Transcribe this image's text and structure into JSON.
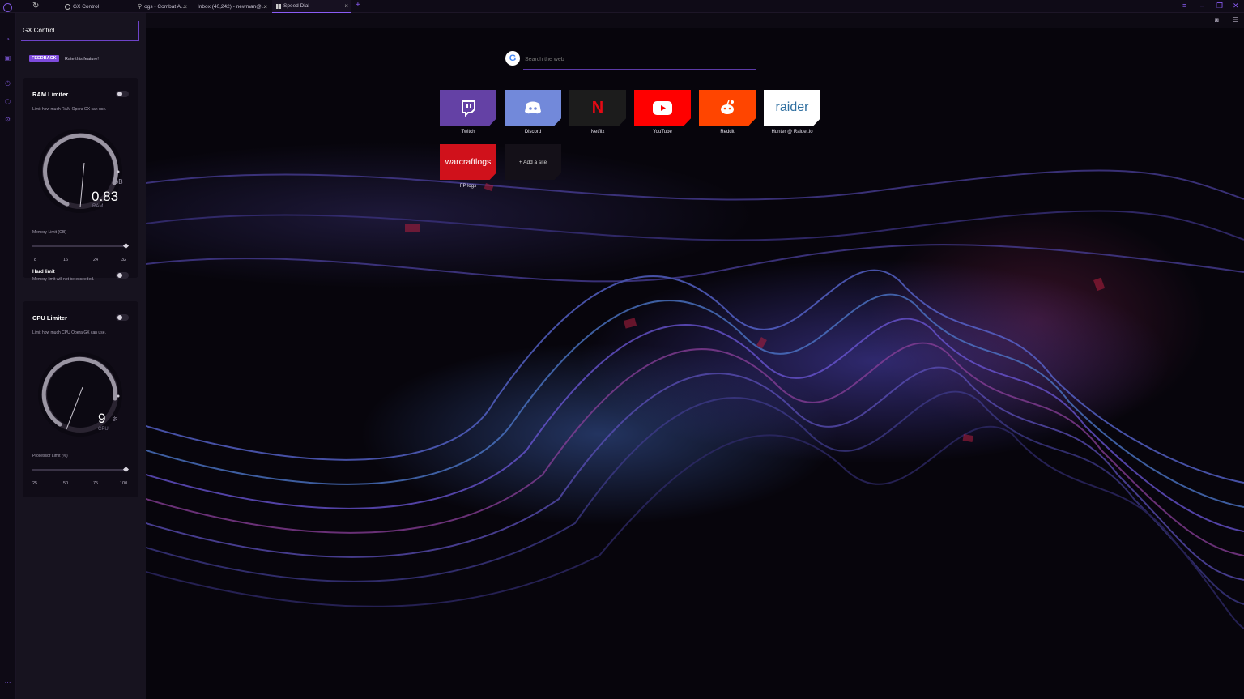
{
  "browser": {
    "tabs": [
      {
        "label": "GX Control",
        "icon": "globe-icon"
      },
      {
        "label": "ogs - Combat A…",
        "icon": "pin-icon"
      },
      {
        "label": "Inbox (40,242) - newman@…",
        "icon": "gmail-icon"
      },
      {
        "label": "Speed Dial",
        "icon": "grid-icon"
      }
    ]
  },
  "panel": {
    "title": "GX Control",
    "feedback_label": "FEEDBACK",
    "rate_text": "Rate this feature!",
    "ram": {
      "title": "RAM Limiter",
      "description": "Limit how much RAM Opera GX can use.",
      "value": "0.83",
      "unit": "GB",
      "sub": "RAM",
      "slider_label": "Memory Limit (GB)",
      "slider_level": 1.0,
      "ticks": [
        "8",
        "16",
        "24",
        "32"
      ],
      "hard_limit_title": "Hard limit",
      "hard_limit_desc": "Memory limit will not be exceeded."
    },
    "cpu": {
      "title": "CPU Limiter",
      "description": "Limit how much CPU Opera GX can use.",
      "value": "9",
      "unit": "%",
      "sub": "CPU",
      "slider_label": "Processor Limit (%)",
      "slider_level": 1.0,
      "ticks": [
        "25",
        "50",
        "75",
        "100"
      ]
    }
  },
  "search": {
    "placeholder": "Search the web"
  },
  "speed_dial": [
    {
      "label": "Twitch",
      "color": "#6441a5",
      "icon": "twitch-icon"
    },
    {
      "label": "Discord",
      "color": "#7289da",
      "icon": "discord-icon"
    },
    {
      "label": "Netflix",
      "color": "#1c1c1c",
      "icon": "netflix-icon",
      "tile_text": "N"
    },
    {
      "label": "YouTube",
      "color": "#ff0000",
      "icon": "youtube-icon"
    },
    {
      "label": "Reddit",
      "color": "#ff4500",
      "icon": "reddit-icon"
    },
    {
      "label": "Hunter @ Raider.io",
      "color": "#ffffff",
      "icon": "raider-logo",
      "tile_text": "raider"
    },
    {
      "label": "FP logs",
      "color": "#d0111b",
      "icon": "warcraftlogs-logo",
      "tile_text": "warcraftlogs"
    },
    {
      "label": "",
      "color": "#141018",
      "icon": "add-icon",
      "tile_text": "+ Add a site"
    }
  ]
}
